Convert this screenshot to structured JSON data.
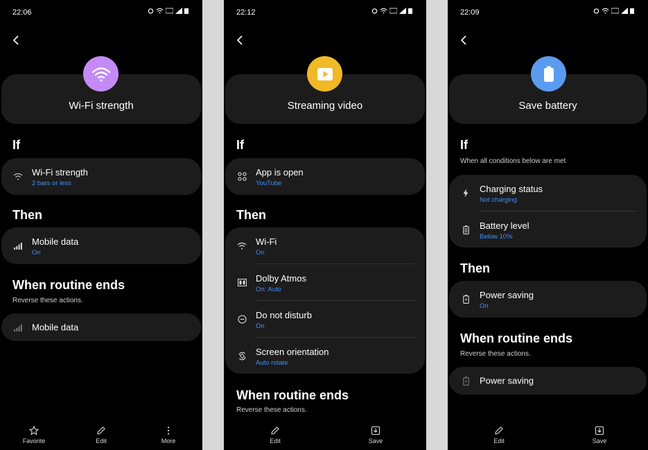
{
  "phones": [
    {
      "status_time": "22:06",
      "title": "Wi-Fi strength",
      "hero_color": "#c58af7",
      "if_heading": "If",
      "if_items": [
        {
          "label": "Wi-Fi strength",
          "value": "2 bars or less",
          "icon": "wifi-weak-icon"
        }
      ],
      "then_heading": "Then",
      "then_items": [
        {
          "label": "Mobile data",
          "value": "On",
          "icon": "signal-icon"
        }
      ],
      "ends_heading": "When routine ends",
      "ends_sub": "Reverse these actions.",
      "ends_items": [
        {
          "label": "Mobile data",
          "icon": "signal-icon"
        }
      ],
      "nav": [
        {
          "label": "Favorite",
          "icon": "star-icon"
        },
        {
          "label": "Edit",
          "icon": "pencil-icon"
        },
        {
          "label": "More",
          "icon": "more-vert-icon"
        }
      ]
    },
    {
      "status_time": "22:12",
      "title": "Streaming video",
      "hero_color": "#f1b928",
      "if_heading": "If",
      "if_items": [
        {
          "label": "App is open",
          "value": "YouTube",
          "icon": "apps-icon"
        }
      ],
      "then_heading": "Then",
      "then_items": [
        {
          "label": "Wi-Fi",
          "value": "On",
          "icon": "wifi-icon"
        },
        {
          "label": "Dolby Atmos",
          "value": "On: Auto",
          "icon": "dolby-icon"
        },
        {
          "label": "Do not disturb",
          "value": "On",
          "icon": "dnd-icon"
        },
        {
          "label": "Screen orientation",
          "value": "Auto rotate",
          "icon": "rotate-icon"
        }
      ],
      "ends_heading": "When routine ends",
      "ends_sub": "Reverse these actions.",
      "nav": [
        {
          "label": "Edit",
          "icon": "pencil-icon"
        },
        {
          "label": "Save",
          "icon": "save-icon"
        }
      ]
    },
    {
      "status_time": "22:09",
      "title": "Save battery",
      "hero_color": "#5b9bef",
      "if_heading": "If",
      "if_sub": "When all conditions below are met",
      "if_items": [
        {
          "label": "Charging status",
          "value": "Not charging",
          "icon": "bolt-icon"
        },
        {
          "label": "Battery level",
          "value": "Below 10%",
          "icon": "battery-icon"
        }
      ],
      "then_heading": "Then",
      "then_items": [
        {
          "label": "Power saving",
          "value": "On",
          "icon": "battery-saver-icon"
        }
      ],
      "ends_heading": "When routine ends",
      "ends_sub": "Reverse these actions.",
      "ends_items": [
        {
          "label": "Power saving",
          "icon": "battery-saver-icon"
        }
      ],
      "nav": [
        {
          "label": "Edit",
          "icon": "pencil-icon"
        },
        {
          "label": "Save",
          "icon": "save-icon"
        }
      ]
    }
  ]
}
